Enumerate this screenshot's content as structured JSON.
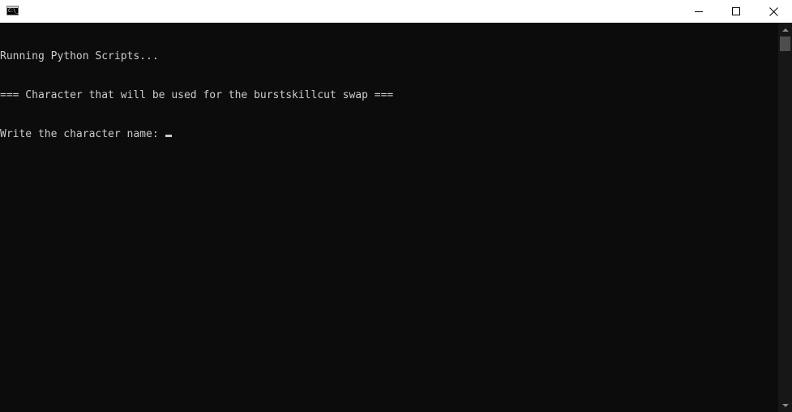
{
  "window": {
    "icon_text": "C:\\_"
  },
  "console": {
    "lines": [
      "Running Python Scripts...",
      "=== Character that will be used for the burstskillcut swap ==="
    ],
    "prompt": "Write the character name: "
  },
  "colors": {
    "background": "#0c0c0c",
    "text": "#cccccc",
    "titlebar": "#ffffff",
    "scrollbar_track": "#171717",
    "scrollbar_thumb": "#4d4d4d"
  }
}
